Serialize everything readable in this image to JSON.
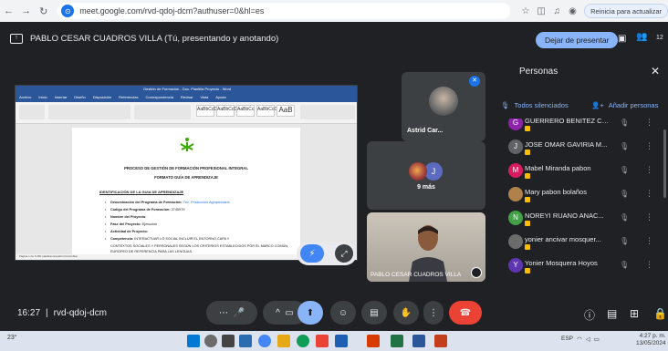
{
  "browser": {
    "url": "meet.google.com/rvd-qdoj-dcm?authuser=0&hl=es",
    "update_label": "Reinicia para actualizar"
  },
  "meet_top": {
    "presenting_text": "PABLO CESAR CUADROS VILLA (Tú, presentando y anotando)",
    "stop_presenting": "Dejar de presentar",
    "participant_count": "12"
  },
  "shared_doc": {
    "window_title": "Gestión de Formación - Doc. Plantilla Proyecto - Word",
    "tabs": [
      "Archivo",
      "Inicio",
      "Insertar",
      "Diseño",
      "Disposición",
      "Referencias",
      "Correspondencia",
      "Revisar",
      "Vista",
      "Ayuda"
    ],
    "styles": [
      "AaBbCcDc",
      "AaBbCcDc",
      "AaBbCc",
      "AaBbCcC",
      "AaB"
    ],
    "heading_1": "PROCESO DE GESTIÓN DE FORMACIÓN PROFESIONAL INTEGRAL",
    "heading_2": "FORMATO GUÍA DE APRENDIZAJE",
    "section": "IDENTIFICACIÓN DE LA GUIA DE APRENDIZAJE",
    "bullets": [
      {
        "label": "Denominación del Programa de Formación:",
        "value": "Téc. Producción Agropecuaria"
      },
      {
        "label": "Código del Programa de Formación:",
        "value": "2745979"
      },
      {
        "label": "Nombre del Proyecto:",
        "value": ""
      },
      {
        "label": "Fase del Proyecto:",
        "value": "Ejecución"
      },
      {
        "label": "Actividad de Proyecto:",
        "value": ""
      },
      {
        "label": "Competencia:",
        "value": "INTERACTUAR LO SOCIAL INCLUIR EL ENTORNO CAPA Y"
      }
    ],
    "paragraph": "CONTEXTOS SOCIALES Y PERSONALES SEGÚN LOS CRITERIOS ESTABLECIDOS POR EL MARCO COMÚN EUROPEO DE REFERENCIA PARA LAS LENGUAS.",
    "status": "Página 1 de 6   250 palabras   Español (Colombia)"
  },
  "tiles": {
    "astrid_name": "Astrid Car...",
    "more_label": "9 más",
    "more_initial": "J",
    "pablo_name": "PABLO CESAR CUADROS VILLA"
  },
  "people_panel": {
    "title": "Personas",
    "mute_all": "Todos silenciados",
    "add_people": "Añadir personas",
    "people": [
      {
        "name": "GUERRERO BENITEZ CHRIS...",
        "initial": "G",
        "color": "#8e24aa"
      },
      {
        "name": "JOSE OMAR GAVIRIA M...",
        "initial": "J",
        "color": "#5f6368"
      },
      {
        "name": "Mabel Miranda pabon",
        "initial": "M",
        "color": "#d81b60"
      },
      {
        "name": "Mary pabon bolaños",
        "initial": "",
        "color": "#b0814b"
      },
      {
        "name": "NOREYI RUANO ANAC...",
        "initial": "N",
        "color": "#43a047"
      },
      {
        "name": "yonier ancivar mosquer...",
        "initial": "",
        "color": "#6b6b6b"
      },
      {
        "name": "Yonier Mosquera Hoyos",
        "initial": "Y",
        "color": "#5e35b1"
      }
    ]
  },
  "meeting": {
    "time": "16:27",
    "separator": "|",
    "code": "rvd-qdoj-dcm"
  },
  "taskbar": {
    "weather": "23°",
    "language": "ESP",
    "language_sub": "LAA",
    "time": "4:27 p. m.",
    "date": "13/05/2024"
  },
  "colors": {
    "accent": "#8ab4f8",
    "leave": "#ea4335",
    "word_blue": "#2b579a",
    "sena_green": "#39a900"
  }
}
